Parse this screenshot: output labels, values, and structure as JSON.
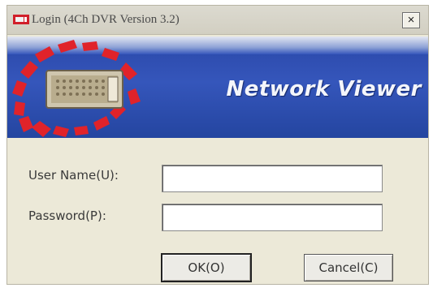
{
  "window": {
    "title": "Login (4Ch DVR Version 3.2)",
    "close_label": "×"
  },
  "banner": {
    "title": "Network Viewer"
  },
  "form": {
    "username_label": "User Name(U):",
    "username_value": "",
    "password_label": "Password(P):",
    "password_value": ""
  },
  "buttons": {
    "ok_label": "OK(O)",
    "cancel_label": "Cancel(C)"
  },
  "colors": {
    "banner_blue": "#2a47a8",
    "accent_red": "#e0232a",
    "dialog_face": "#ece9d8"
  }
}
